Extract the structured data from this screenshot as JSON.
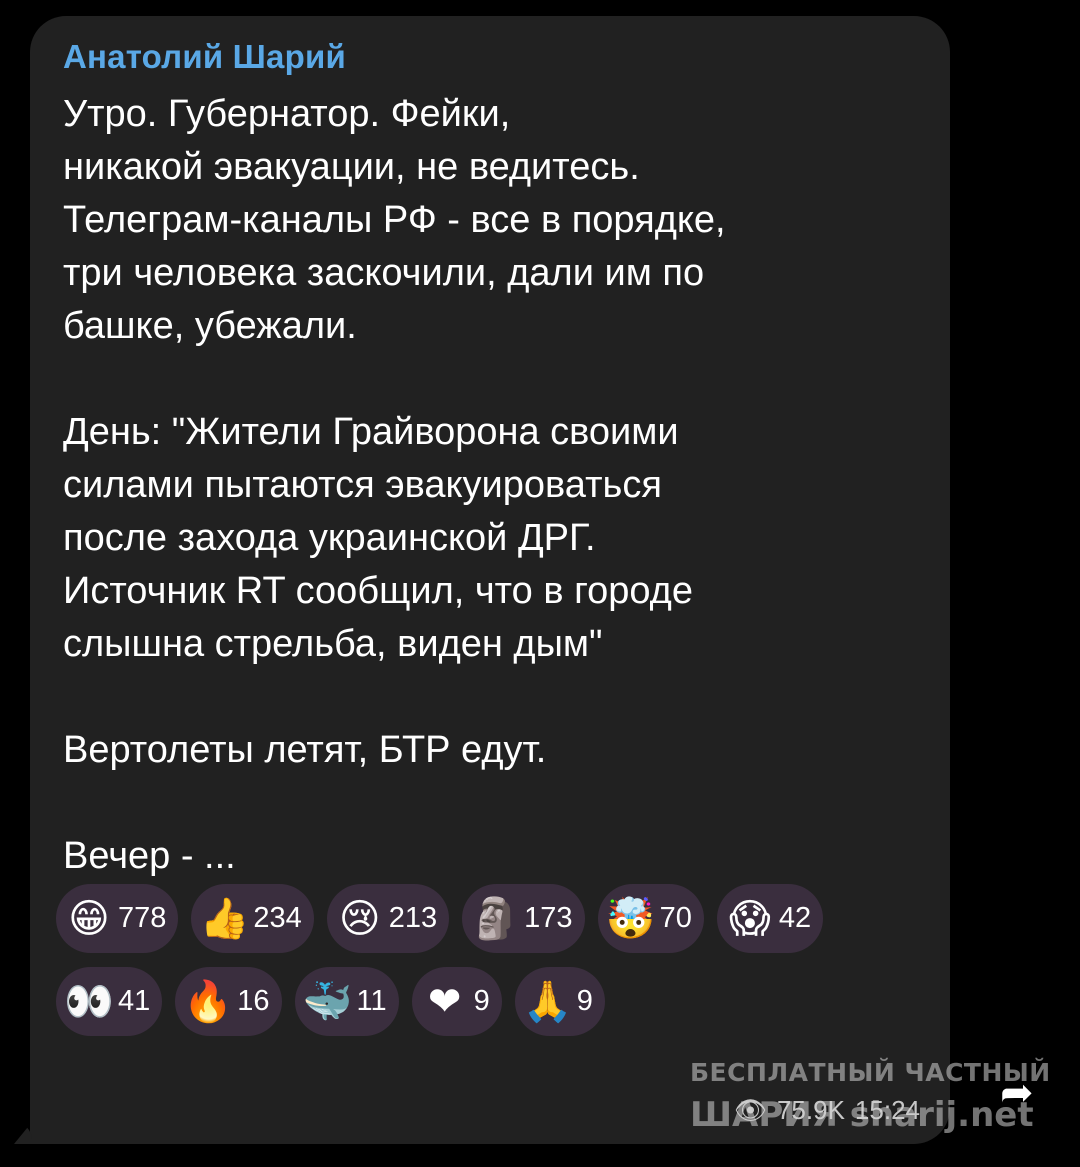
{
  "post": {
    "author": "Анатолий Шарий",
    "text": "Утро. Губернатор. Фейки,\nникакой эвакуации, не ведитесь.\nТелеграм-каналы РФ - все в порядке,\nтри человека заскочили, дали им по\nбашке, убежали.\n\nДень: \"Жители Грайворона своими\nсилами пытаются эвакуироваться\nпосле захода украинской ДРГ.\nИсточник RT сообщил, что в городе\nслышна стрельба, виден дым\"\n\nВертолеты летят, БТР едут.\n\nВечер - ...",
    "views": "75.9K",
    "time": "15:24"
  },
  "reactions": [
    {
      "emoji": "😁",
      "count": "778",
      "icon": "grinning-face-icon"
    },
    {
      "emoji": "👍",
      "count": "234",
      "icon": "thumbs-up-icon"
    },
    {
      "emoji": "😢",
      "count": "213",
      "icon": "crying-face-icon"
    },
    {
      "emoji": "🗿",
      "count": "173",
      "icon": "moai-icon"
    },
    {
      "emoji": "🤯",
      "count": "70",
      "icon": "exploding-head-icon"
    },
    {
      "emoji": "😱",
      "count": "42",
      "icon": "screaming-face-icon"
    },
    {
      "emoji": "👀",
      "count": "41",
      "icon": "eyes-icon"
    },
    {
      "emoji": "🔥",
      "count": "16",
      "icon": "fire-icon"
    },
    {
      "emoji": "🐳",
      "count": "11",
      "icon": "whale-icon"
    },
    {
      "emoji": "❤",
      "count": "9",
      "icon": "heart-icon"
    },
    {
      "emoji": "🙏",
      "count": "9",
      "icon": "folded-hands-icon"
    }
  ],
  "watermark": {
    "line1": "БЕСПЛАТНЫЙ ЧАСТНЫЙ",
    "line2": "ШАРИЯ sharij.net"
  },
  "colors": {
    "background": "#000000",
    "bubble": "#212121",
    "author": "#5aa8e6",
    "reaction_chip": "#3a2e3e"
  }
}
